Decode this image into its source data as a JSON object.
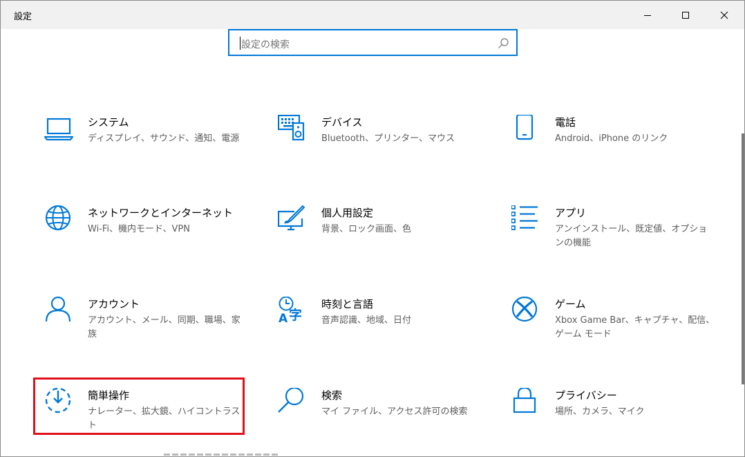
{
  "window": {
    "title": "設定"
  },
  "search": {
    "placeholder": "設定の検索",
    "value": ""
  },
  "tiles": [
    {
      "id": "system",
      "title": "システム",
      "description": "ディスプレイ、サウンド、通知、電源",
      "icon": "laptop-icon"
    },
    {
      "id": "devices",
      "title": "デバイス",
      "description": "Bluetooth、プリンター、マウス",
      "icon": "keyboard-speaker-icon"
    },
    {
      "id": "phone",
      "title": "電話",
      "description": "Android、iPhone のリンク",
      "icon": "phone-icon"
    },
    {
      "id": "network",
      "title": "ネットワークとインターネット",
      "description": "Wi-Fi、機内モード、VPN",
      "icon": "globe-icon"
    },
    {
      "id": "personalization",
      "title": "個人用設定",
      "description": "背景、ロック画面、色",
      "icon": "brush-monitor-icon"
    },
    {
      "id": "apps",
      "title": "アプリ",
      "description": "アンインストール、既定値、オプションの機能",
      "icon": "list-icon"
    },
    {
      "id": "accounts",
      "title": "アカウント",
      "description": "アカウント、メール、同期、職場、家族",
      "icon": "person-icon"
    },
    {
      "id": "time-language",
      "title": "時刻と言語",
      "description": "音声認識、地域、日付",
      "icon": "clock-language-icon"
    },
    {
      "id": "gaming",
      "title": "ゲーム",
      "description": "Xbox Game Bar、キャプチャ、配信、ゲーム モード",
      "icon": "xbox-icon"
    },
    {
      "id": "ease-of-access",
      "title": "簡単操作",
      "description": "ナレーター、拡大鏡、ハイコントラスト",
      "icon": "ease-of-access-icon",
      "highlighted": true
    },
    {
      "id": "search",
      "title": "検索",
      "description": "マイ ファイル、アクセス許可の検索",
      "icon": "magnifier-icon"
    },
    {
      "id": "privacy",
      "title": "プライバシー",
      "description": "場所、カメラ、マイク",
      "icon": "lock-icon"
    }
  ],
  "colors": {
    "accent": "#0078d7",
    "highlight": "#e0101a",
    "titlebar": "#f1f1f1",
    "description": "#5d5d5d"
  }
}
